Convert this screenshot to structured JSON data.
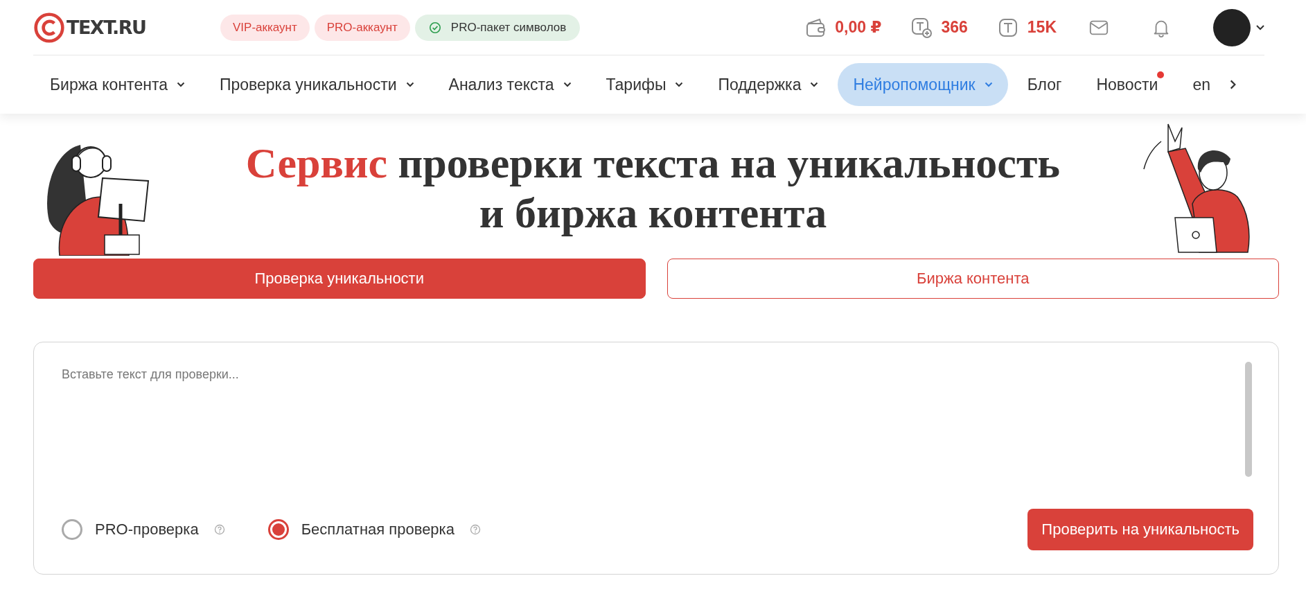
{
  "header": {
    "logo": "TEXT.RU",
    "badges": [
      {
        "label": "VIP-аккаунт",
        "kind": "account"
      },
      {
        "label": "PRO-аккаунт",
        "kind": "account"
      },
      {
        "label": "PRO-пакет символов",
        "kind": "package"
      }
    ],
    "stats": [
      {
        "kind": "wallet",
        "value": "0,00 ₽"
      },
      {
        "kind": "symbols-plus",
        "value": "366"
      },
      {
        "kind": "symbols",
        "value": "15K"
      }
    ]
  },
  "nav": [
    {
      "label": "Биржа контента",
      "dropdown": true,
      "selected": false,
      "unread": false
    },
    {
      "label": "Проверка уникальности",
      "dropdown": true,
      "selected": false,
      "unread": false
    },
    {
      "label": "Анализ текста",
      "dropdown": true,
      "selected": false,
      "unread": false
    },
    {
      "label": "Тарифы",
      "dropdown": true,
      "selected": false,
      "unread": false
    },
    {
      "label": "Поддержка",
      "dropdown": true,
      "selected": false,
      "unread": false
    },
    {
      "label": "Нейропомощник",
      "dropdown": true,
      "selected": true,
      "unread": false
    },
    {
      "label": "Блог",
      "dropdown": false,
      "selected": false,
      "unread": false
    },
    {
      "label": "Новости",
      "dropdown": false,
      "selected": false,
      "unread": true
    },
    {
      "label": "en",
      "dropdown": false,
      "selected": false,
      "unread": false
    }
  ],
  "hero": {
    "title_accent": "Сервис",
    "title_rest": "проверки текста на уникальность",
    "title_line2": "и биржа контента"
  },
  "tabs": [
    {
      "label": "Проверка уникальности",
      "selected": true
    },
    {
      "label": "Биржа контента",
      "selected": false
    }
  ],
  "checker": {
    "placeholder": "Вставьте текст для проверки...",
    "modes": [
      {
        "label": "PRO-проверка",
        "selected": false
      },
      {
        "label": "Бесплатная проверка",
        "selected": true
      }
    ],
    "submit": "Проверить на уникальность"
  }
}
